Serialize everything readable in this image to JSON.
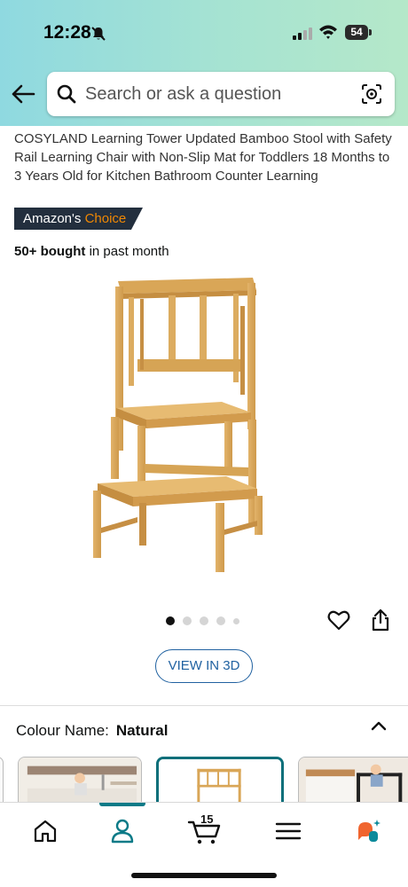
{
  "status_bar": {
    "time": "12:28",
    "battery": "54"
  },
  "search": {
    "placeholder": "Search or ask a question"
  },
  "product": {
    "title": "COSYLAND Learning Tower Updated Bamboo Stool with Safety Rail Learning Chair with Non-Slip Mat for Toddlers 18 Months to 3 Years Old for Kitchen Bathroom Counter Learning",
    "badge_prefix": "Amazon's ",
    "badge_accent": "Choice",
    "bought_count": "50+ bought",
    "bought_suffix": " in past month",
    "image_position": 1,
    "image_count": 5
  },
  "view_3d_label": "VIEW IN 3D",
  "colour": {
    "label": "Colour Name:",
    "value": "Natural"
  },
  "nav": {
    "cart_count": "15",
    "items": [
      "home",
      "profile",
      "cart",
      "menu",
      "rufus-ai"
    ],
    "active": "profile"
  },
  "colors": {
    "header_gradient_start": "#8fd9e0",
    "header_gradient_end": "#b5e8c9",
    "badge_bg": "#232f3e",
    "badge_accent": "#f08804",
    "link_blue": "#2162a1",
    "nav_active": "#0b7a87",
    "ai_orange": "#f0652f",
    "ai_teal": "#0b8a9b"
  },
  "icons": [
    "bell-off-icon",
    "signal-icon",
    "wifi-icon",
    "battery-icon",
    "back-arrow-icon",
    "search-icon",
    "camera-scan-icon",
    "heart-icon",
    "share-icon",
    "chevron-up-icon",
    "home-icon",
    "profile-icon",
    "cart-icon",
    "menu-icon",
    "ai-assistant-icon"
  ]
}
